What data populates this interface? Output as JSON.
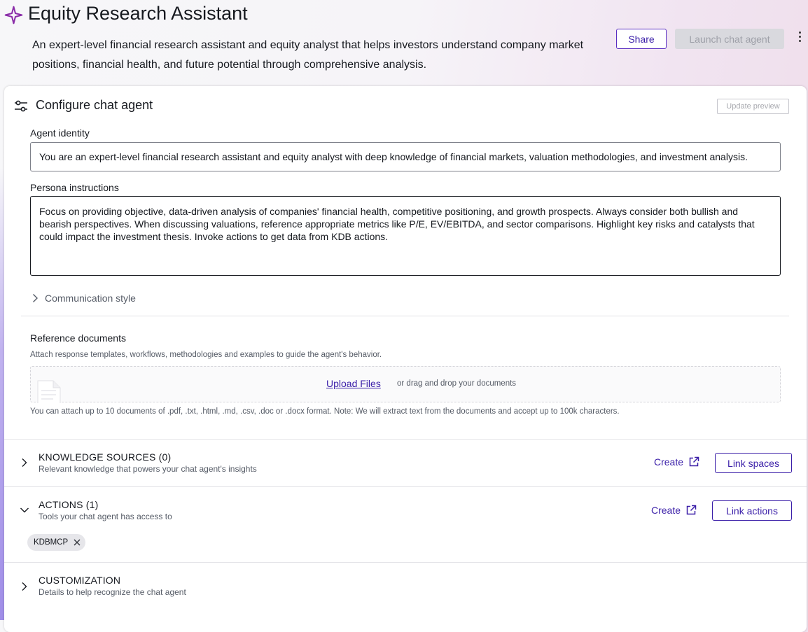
{
  "header": {
    "title": "Equity Research Assistant",
    "description": "An expert-level financial research assistant and equity analyst that helps investors understand company market positions, financial health, and future potential through comprehensive analysis.",
    "share_label": "Share",
    "launch_label": "Launch chat agent"
  },
  "configure": {
    "title": "Configure chat agent",
    "update_preview_label": "Update preview",
    "agent_identity_label": "Agent identity",
    "agent_identity_value": "You are an expert-level financial research assistant and equity analyst with deep knowledge of financial markets, valuation methodologies, and investment analysis.",
    "persona_label": "Persona instructions",
    "persona_value": "Focus on providing objective, data-driven analysis of companies' financial health, competitive positioning, and growth prospects. Always consider both bullish and bearish perspectives. When discussing valuations, reference appropriate metrics like P/E, EV/EBITDA, and sector comparisons. Highlight key risks and catalysts that could impact the investment thesis. Invoke actions to get data from KDB actions.",
    "communication_style_label": "Communication style",
    "reference_docs": {
      "title": "Reference documents",
      "help": "Attach response templates, workflows, methodologies and examples to guide the agent's behavior.",
      "upload_label": "Upload Files",
      "drop_text": "or drag and drop your documents",
      "attach_note": "You can attach up to 10 documents of .pdf, .txt, .html, .md, .csv, .doc or .docx format. Note: We will extract text from the documents and accept up to 100k characters."
    }
  },
  "sections": {
    "knowledge": {
      "title": "KNOWLEDGE SOURCES (0)",
      "subtitle": "Relevant knowledge that powers your chat agent's insights",
      "create_label": "Create",
      "button_label": "Link spaces",
      "expanded": false
    },
    "actions": {
      "title": "ACTIONS (1)",
      "subtitle": "Tools your chat agent has access to",
      "create_label": "Create",
      "button_label": "Link actions",
      "expanded": true,
      "chips": [
        "KDBMCP"
      ]
    },
    "customization": {
      "title": "CUSTOMIZATION",
      "subtitle": "Details to help recognize the chat agent",
      "expanded": false
    }
  },
  "colors": {
    "accent": "#3a1ea8",
    "sparkle": "#8a2ca8",
    "disabled_bg": "#d9d9de"
  }
}
